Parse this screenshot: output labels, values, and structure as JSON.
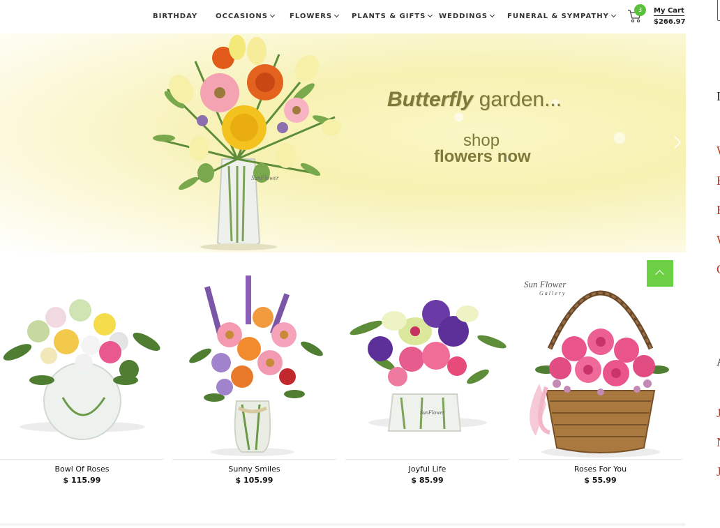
{
  "nav": {
    "items": [
      {
        "label": "BIRTHDAY",
        "has_dropdown": false
      },
      {
        "label": "OCCASIONS",
        "has_dropdown": true
      },
      {
        "label": "FLOWERS",
        "has_dropdown": true
      },
      {
        "label": "PLANTS & GIFTS",
        "has_dropdown": true
      },
      {
        "label": "WEDDINGS",
        "has_dropdown": true
      },
      {
        "label": "FUNERAL & SYMPATHY",
        "has_dropdown": true
      }
    ]
  },
  "cart": {
    "icon": "shopping-cart-icon",
    "count": "3",
    "label": "My Cart",
    "total": "$266.97"
  },
  "hero": {
    "headline_bold": "Butterfly",
    "headline_rest": " garden...",
    "shop": "shop",
    "cta": "flowers now",
    "watermark": "SunFlower"
  },
  "products": [
    {
      "name": "Bowl Of Roses",
      "price": "$ 115.99"
    },
    {
      "name": "Sunny Smiles",
      "price": "$ 105.99"
    },
    {
      "name": "Joyful Life",
      "price": "$ 85.99"
    },
    {
      "name": "Roses For You",
      "price": "$ 55.99"
    }
  ],
  "brand_mark": {
    "line1": "Sun Flower",
    "line2": "Gallery"
  },
  "colors": {
    "accent_green": "#6ccf44",
    "badge_green": "#59c13b",
    "hero_text": "#7e7a3a"
  }
}
